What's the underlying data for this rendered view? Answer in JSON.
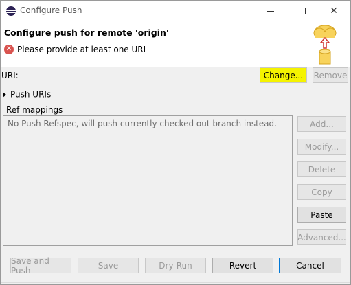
{
  "window": {
    "title": "Configure Push",
    "icon": "eclipse-icon"
  },
  "header": {
    "title": "Configure push for remote 'origin'",
    "error_message": "Please provide at least one URI",
    "error_icon": "error-icon",
    "banner_icon": "push-to-cloud-icon"
  },
  "uri": {
    "label": "URI:",
    "change_label": "Change...",
    "remove_label": "Remove"
  },
  "push_uris": {
    "label": "Push URIs"
  },
  "ref_mappings": {
    "label": "Ref mappings",
    "empty_text": "No Push Refspec, will push currently checked out branch instead.",
    "buttons": {
      "add": "Add...",
      "modify": "Modify...",
      "delete": "Delete",
      "copy": "Copy",
      "paste": "Paste",
      "advanced": "Advanced..."
    }
  },
  "footer": {
    "save_and_push": "Save and Push",
    "save": "Save",
    "dry_run": "Dry-Run",
    "revert": "Revert",
    "cancel": "Cancel"
  },
  "colors": {
    "highlight": "#f5f300",
    "error": "#d9534f",
    "disabled_text": "#9a9a9a"
  }
}
